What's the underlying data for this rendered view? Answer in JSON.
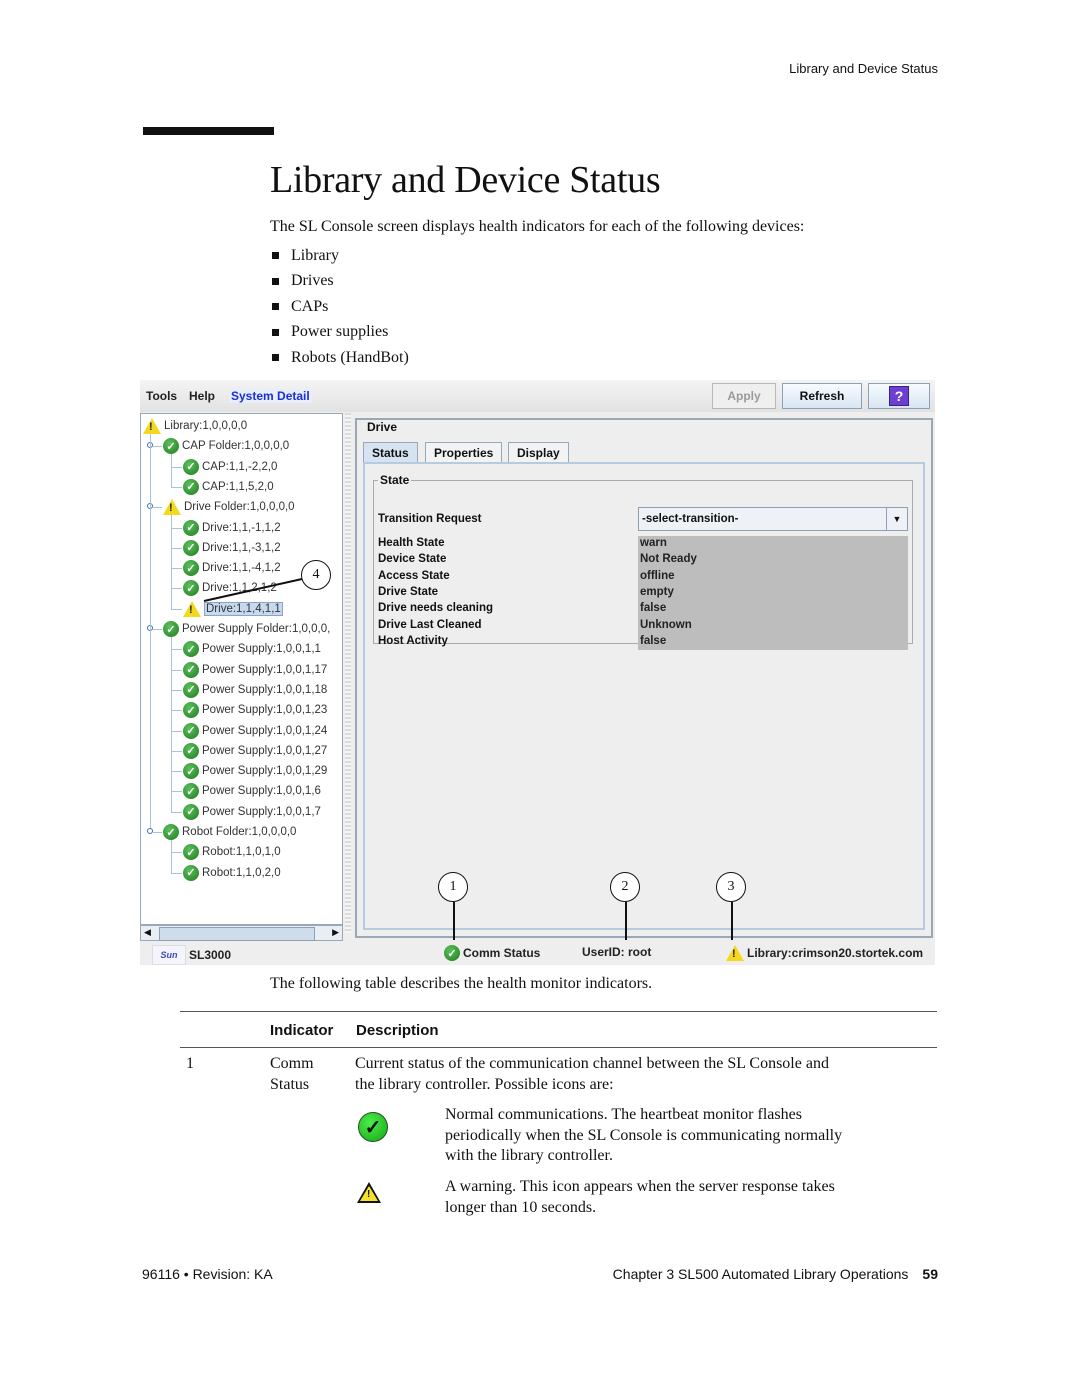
{
  "running_head": "Library and Device Status",
  "title": "Library and Device Status",
  "intro": "The SL Console screen displays health indicators for each of the following devices:",
  "bullets": [
    "Library",
    "Drives",
    "CAPs",
    "Power supplies",
    "Robots (HandBot)"
  ],
  "screenshot": {
    "menu": {
      "tools": "Tools",
      "help": "Help",
      "system_detail": "System Detail"
    },
    "toolbar": {
      "apply": "Apply",
      "refresh": "Refresh",
      "help_icon": "?"
    },
    "tree": [
      {
        "label": "Library:1,0,0,0,0",
        "status": "warn",
        "level": 0
      },
      {
        "label": "CAP Folder:1,0,0,0,0",
        "status": "ok",
        "level": 1
      },
      {
        "label": "CAP:1,1,-2,2,0",
        "status": "ok",
        "level": 2
      },
      {
        "label": "CAP:1,1,5,2,0",
        "status": "ok",
        "level": 2
      },
      {
        "label": "Drive Folder:1,0,0,0,0",
        "status": "warn",
        "level": 1
      },
      {
        "label": "Drive:1,1,-1,1,2",
        "status": "ok",
        "level": 2
      },
      {
        "label": "Drive:1,1,-3,1,2",
        "status": "ok",
        "level": 2
      },
      {
        "label": "Drive:1,1,-4,1,2",
        "status": "ok",
        "level": 2
      },
      {
        "label": "Drive:1,1,2,1,2",
        "status": "ok",
        "level": 2
      },
      {
        "label": "Drive:1,1,4,1,1",
        "status": "warn",
        "level": 2,
        "selected": true
      },
      {
        "label": "Power Supply Folder:1,0,0,0,",
        "status": "ok",
        "level": 1
      },
      {
        "label": "Power Supply:1,0,0,1,1",
        "status": "ok",
        "level": 2
      },
      {
        "label": "Power Supply:1,0,0,1,17",
        "status": "ok",
        "level": 2
      },
      {
        "label": "Power Supply:1,0,0,1,18",
        "status": "ok",
        "level": 2
      },
      {
        "label": "Power Supply:1,0,0,1,23",
        "status": "ok",
        "level": 2
      },
      {
        "label": "Power Supply:1,0,0,1,24",
        "status": "ok",
        "level": 2
      },
      {
        "label": "Power Supply:1,0,0,1,27",
        "status": "ok",
        "level": 2
      },
      {
        "label": "Power Supply:1,0,0,1,29",
        "status": "ok",
        "level": 2
      },
      {
        "label": "Power Supply:1,0,0,1,6",
        "status": "ok",
        "level": 2
      },
      {
        "label": "Power Supply:1,0,0,1,7",
        "status": "ok",
        "level": 2
      },
      {
        "label": "Robot Folder:1,0,0,0,0",
        "status": "ok",
        "level": 1
      },
      {
        "label": "Robot:1,1,0,1,0",
        "status": "ok",
        "level": 2
      },
      {
        "label": "Robot:1,1,0,2,0",
        "status": "ok",
        "level": 2
      }
    ],
    "detail": {
      "group_title": "Drive",
      "tabs": [
        "Status",
        "Properties",
        "Display"
      ],
      "active_tab": "Status",
      "state_title": "State",
      "transition_label": "Transition Request",
      "transition_value": "-select-transition-",
      "rows": [
        {
          "label": "Health State",
          "value": "warn"
        },
        {
          "label": "Device State",
          "value": "Not Ready"
        },
        {
          "label": "Access State",
          "value": "offline"
        },
        {
          "label": "Drive State",
          "value": "empty"
        },
        {
          "label": "Drive needs cleaning",
          "value": "false"
        },
        {
          "label": "Drive Last Cleaned",
          "value": "Unknown"
        },
        {
          "label": "Host Activity",
          "value": "false"
        }
      ]
    },
    "statusbar": {
      "logo": "Sun",
      "product": "SL3000",
      "comm_status": "Comm Status",
      "user_id": "UserID: root",
      "library": "Library:crimson20.stortek.com"
    },
    "callouts": [
      "1",
      "2",
      "3",
      "4"
    ]
  },
  "following": "The following table describes the health monitor indicators.",
  "table": {
    "headers": [
      "Indicator",
      "Description"
    ],
    "row": {
      "num": "1",
      "indicator_line1": "Comm",
      "indicator_line2": "Status",
      "desc_line1": "Current status of the communication channel between the SL Console and",
      "desc_line2": "the library controller. Possible icons are:",
      "icons": [
        {
          "icon": "green-check",
          "text1": "Normal communications. The heartbeat monitor flashes",
          "text2": "periodically when the SL Console is communicating normally",
          "text3": "with the library controller."
        },
        {
          "icon": "warning-triangle",
          "text1": "A warning. This icon appears when the server response takes",
          "text2": "longer than 10 seconds."
        }
      ]
    }
  },
  "footer": {
    "left": "96116 • Revision: KA",
    "chapter": "Chapter 3 SL500 Automated Library Operations",
    "page": "59"
  }
}
